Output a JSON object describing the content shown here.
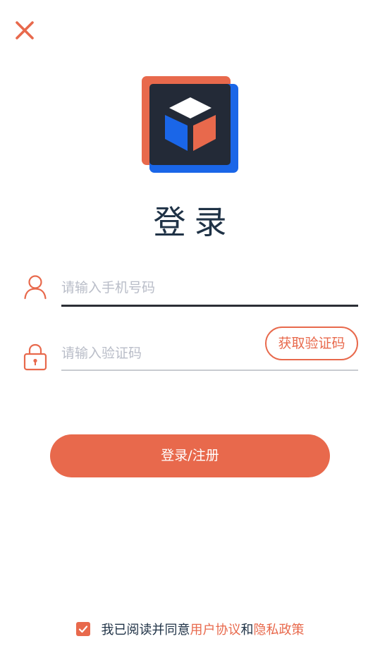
{
  "colors": {
    "accent": "#e8694c",
    "title": "#1f3246",
    "logo_blue": "#1a66e8",
    "logo_dark": "#232a37",
    "placeholder": "#b9bdc8"
  },
  "header": {
    "close_icon": "close-icon"
  },
  "logo": {
    "icon": "cube-logo"
  },
  "title": "登录",
  "phone": {
    "icon": "user-icon",
    "placeholder": "请输入手机号码",
    "value": ""
  },
  "code": {
    "icon": "lock-icon",
    "placeholder": "请输入验证码",
    "value": "",
    "button_label": "获取验证码"
  },
  "submit_label": "登录/注册",
  "agreement": {
    "checked": true,
    "prefix": "我已阅读并同意",
    "user_agreement": "用户协议",
    "conjunction": "和",
    "privacy_policy": "隐私政策"
  }
}
